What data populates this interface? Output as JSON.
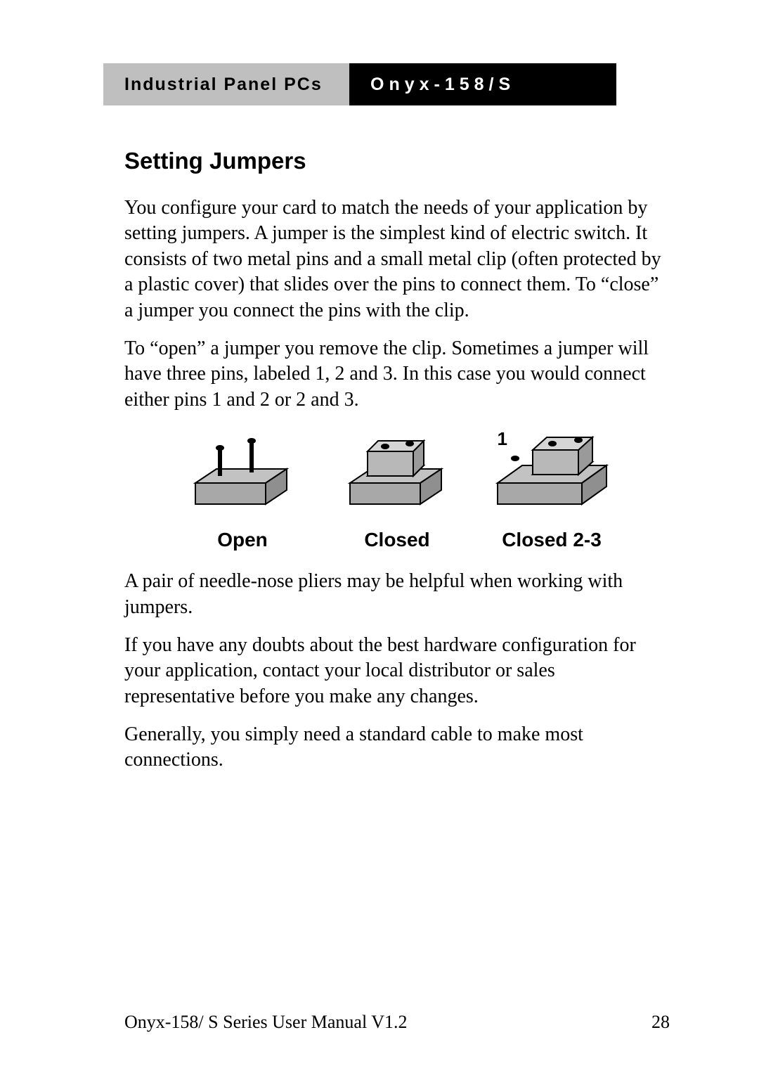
{
  "header": {
    "left": "Industrial Panel PCs",
    "right": "Onyx-158/S"
  },
  "section_title": "Setting Jumpers",
  "paragraphs": {
    "p1": "You configure your card to match the needs of your application by setting jumpers. A jumper is the simplest kind of electric switch. It consists of two metal pins and a small metal clip (often protected by a plastic cover) that slides over the pins to connect them. To “close” a jumper you connect the pins with the clip.",
    "p2": "To “open” a jumper you remove the clip. Sometimes a jumper will have three pins, labeled 1, 2 and 3. In this case you would connect either pins 1 and 2 or 2 and 3.",
    "p3": "A pair of needle-nose pliers may be helpful when working with jumpers.",
    "p4": "If you have any doubts about the best hardware configuration for your application, contact your local distributor or sales representative before you make any changes.",
    "p5": "Generally, you simply need a standard cable to make most connections."
  },
  "diagrams": {
    "open": {
      "caption": "Open"
    },
    "closed": {
      "caption": "Closed"
    },
    "closed23": {
      "caption": "Closed 2-3",
      "pin_label": "1"
    }
  },
  "footer": {
    "manual": "Onyx-158/ S Series User Manual V1.2",
    "page_no": "28"
  }
}
